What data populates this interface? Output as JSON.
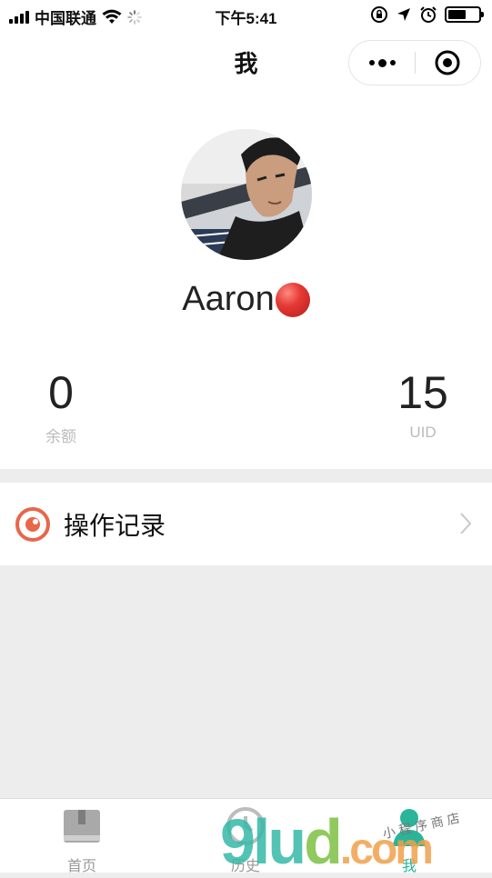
{
  "status_bar": {
    "carrier": "中国联通",
    "time": "下午5:41",
    "battery_level": 0.6,
    "icons": [
      "signal-icon",
      "wifi-icon",
      "loading-icon",
      "lock-rotation-icon",
      "location-icon",
      "alarm-icon",
      "battery-icon"
    ]
  },
  "nav": {
    "title": "我",
    "capsule_icons": [
      "more-icon",
      "close-target-icon"
    ]
  },
  "profile": {
    "username": "Aaron",
    "stats": [
      {
        "value": "0",
        "label": "余额"
      },
      {
        "value": "15",
        "label": "UID"
      }
    ]
  },
  "menu": {
    "records_label": "操作记录"
  },
  "tabs": [
    {
      "label": "首页",
      "icon": "book-icon",
      "active": false
    },
    {
      "label": "历史",
      "icon": "clock-icon",
      "active": false
    },
    {
      "label": "我",
      "icon": "person-icon",
      "active": true
    }
  ],
  "watermark": {
    "brand_a": "9lu",
    "brand_b": "d",
    "brand_c": ".com",
    "note": "小程序商店"
  },
  "colors": {
    "accent": "#e8664a",
    "tab_active": "#2ab49a",
    "muted": "#bbbbbb",
    "background": "#ededed"
  }
}
